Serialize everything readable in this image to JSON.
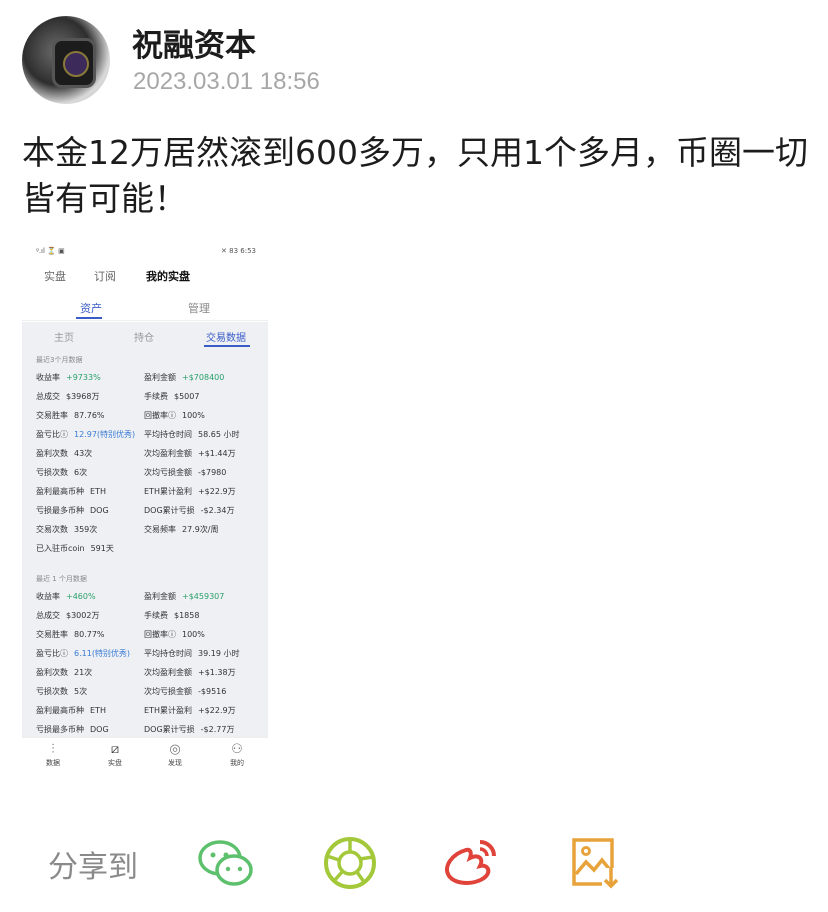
{
  "post": {
    "author": "祝融资本",
    "time": "2023.03.01 18:56",
    "text": "本金12万居然滚到600多万，只用1个多月，币圈一切皆有可能！"
  },
  "screenshot": {
    "status": {
      "left": "ᵍ.ıl ⏳ ▣",
      "right": "✕ 83 6:53"
    },
    "nav": [
      "实盘",
      "订阅",
      "我的实盘"
    ],
    "subtabs": [
      "资产",
      "管理"
    ],
    "tabs": [
      "主页",
      "持仓",
      "交易数据"
    ],
    "section1": "最近3个月数据",
    "rows1": [
      {
        "a_label": "收益率",
        "a_value": "+9733%",
        "b_label": "盈利金额",
        "b_value": "+$708400"
      },
      {
        "a_label": "总成交",
        "a_value": "$3968万",
        "b_label": "手续费",
        "b_value": "$5007"
      },
      {
        "a_label": "交易胜率",
        "a_value": "87.76%",
        "b_label": "回撤率ⓘ",
        "b_value": "100%"
      },
      {
        "a_label": "盈亏比ⓘ",
        "a_value": "12.97(特别优秀)",
        "b_label": "平均持仓时间",
        "b_value": "58.65 小时"
      },
      {
        "a_label": "盈利次数",
        "a_value": "43次",
        "b_label": "次均盈利金额",
        "b_value": "+$1.44万"
      },
      {
        "a_label": "亏损次数",
        "a_value": "6次",
        "b_label": "次均亏损金额",
        "b_value": "-$7980"
      },
      {
        "a_label": "盈利最高币种",
        "a_value": "ETH",
        "b_label": "ETH累计盈利",
        "b_value": "+$22.9万"
      },
      {
        "a_label": "亏损最多币种",
        "a_value": "DOG",
        "b_label": "DOG累计亏损",
        "b_value": "-$2.34万"
      },
      {
        "a_label": "交易次数",
        "a_value": "359次",
        "b_label": "交易频率",
        "b_value": "27.9次/周"
      },
      {
        "a_label": "已入驻币coin",
        "a_value": "591天",
        "b_label": "",
        "b_value": ""
      }
    ],
    "section2": "最近 1 个月数据",
    "rows2": [
      {
        "a_label": "收益率",
        "a_value": "+460%",
        "b_label": "盈利金额",
        "b_value": "+$459307"
      },
      {
        "a_label": "总成交",
        "a_value": "$3002万",
        "b_label": "手续费",
        "b_value": "$1858"
      },
      {
        "a_label": "交易胜率",
        "a_value": "80.77%",
        "b_label": "回撤率ⓘ",
        "b_value": "100%"
      },
      {
        "a_label": "盈亏比ⓘ",
        "a_value": "6.11(特别优秀)",
        "b_label": "平均持仓时间",
        "b_value": "39.19 小时"
      },
      {
        "a_label": "盈利次数",
        "a_value": "21次",
        "b_label": "次均盈利金额",
        "b_value": "+$1.38万"
      },
      {
        "a_label": "亏损次数",
        "a_value": "5次",
        "b_label": "次均亏损金额",
        "b_value": "-$9516"
      },
      {
        "a_label": "盈利最高币种",
        "a_value": "ETH",
        "b_label": "ETH累计盈利",
        "b_value": "+$22.9万"
      },
      {
        "a_label": "亏损最多币种",
        "a_value": "DOG",
        "b_label": "DOG累计亏损",
        "b_value": "-$2.77万"
      }
    ],
    "bottom_nav": [
      "数据",
      "实盘",
      "发现",
      "我的"
    ]
  },
  "share": {
    "label": "分享到"
  },
  "colors": {
    "accent": "#3a5cc7",
    "positive": "#2aa06a",
    "ratio": "#3a7bd5"
  },
  "icons": [
    "wechat-icon",
    "moments-icon",
    "weibo-icon",
    "save-image-icon"
  ]
}
